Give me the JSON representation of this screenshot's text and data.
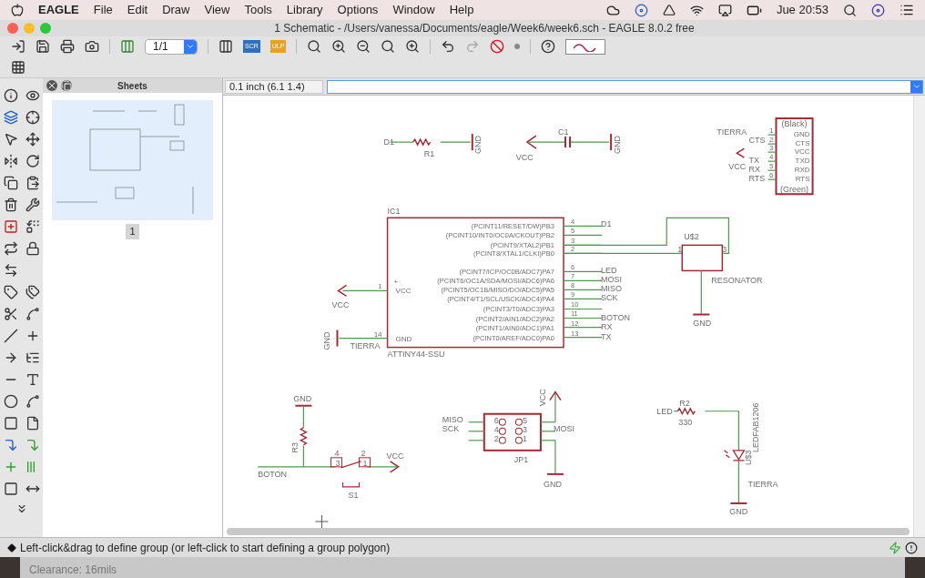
{
  "menubar": {
    "app": "EAGLE",
    "items": [
      "File",
      "Edit",
      "Draw",
      "View",
      "Tools",
      "Library",
      "Options",
      "Window",
      "Help"
    ],
    "clock": "Jue 20:53"
  },
  "window": {
    "title": "1 Schematic - /Users/vanessa/Documents/eagle/Week6/week6.sch - EAGLE 8.0.2 free"
  },
  "toolbar": {
    "sheet_select": "1/1",
    "script_label": "SCR",
    "ulp_label": "ULP"
  },
  "sheets_panel": {
    "title": "Sheets",
    "sheets": [
      {
        "label": "1",
        "selected": true
      }
    ]
  },
  "command_bar": {
    "grid_readout": "0.1 inch (6.1 1.4)"
  },
  "schematic": {
    "labels": [
      "D1",
      "R1",
      "GND",
      "C1",
      "VCC",
      "GND",
      "TIERRA",
      "CTS",
      "VCC",
      "TX",
      "RX",
      "RTS",
      "D1",
      "LED",
      "MOSI",
      "MISO",
      "SCK",
      "BOTON",
      "RX",
      "TX",
      "VCC",
      "GND",
      "TIERRA",
      "U$2",
      "1",
      "3",
      "RESONATOR",
      "GND",
      "GND",
      "R3",
      "BOTON",
      "4",
      "2",
      "3",
      "1",
      "VCC",
      "S1",
      "MISO",
      "SCK",
      "MOSI",
      "JP1",
      "VCC",
      "GND",
      "6",
      "4",
      "2",
      "5",
      "3",
      "1",
      "LED",
      "R2",
      "330",
      "U$3",
      "LEDFAB1206",
      "TIERRA",
      "GND"
    ],
    "connector": {
      "header": "(Black)",
      "footer": "(Green)",
      "pins": [
        {
          "name": "GND",
          "number": "1"
        },
        {
          "name": "CTS",
          "number": "2"
        },
        {
          "name": "VCC",
          "number": "3"
        },
        {
          "name": "TXD",
          "number": "4"
        },
        {
          "name": "RXD",
          "number": "5"
        },
        {
          "name": "RTS",
          "number": "6"
        }
      ]
    },
    "ic": {
      "name": "IC1",
      "value": "ATTINY44-SSU",
      "left_pins": [
        {
          "name": "VCC",
          "number": "1",
          "symbol": "+"
        },
        {
          "name": "GND",
          "number": "14"
        }
      ],
      "right_pins": [
        {
          "name": "(PCINT11/RESET/DW)PB3",
          "number": "4"
        },
        {
          "name": "(PCINT10/INT0/OC0A/CKOUT)PB2",
          "number": "5"
        },
        {
          "name": "(PCINT9/XTAL2)PB1",
          "number": "3"
        },
        {
          "name": "(PCINT8/XTAL1/CLKI)PB0",
          "number": "2"
        },
        {
          "name": "(PCINT7/ICP/OC0B/ADC7)PA7",
          "number": "6"
        },
        {
          "name": "(PCINT6/OC1A/SDA/MOSI/ADC6)PA6",
          "number": "7"
        },
        {
          "name": "(PCINT5/OC1B/MISO/DO/ADC5)PA5",
          "number": "8"
        },
        {
          "name": "(PCINT4/T1/SCL/USCK/ADC4)PA4",
          "number": "9"
        },
        {
          "name": "(PCINT3/T0/ADC3)PA3",
          "number": "10"
        },
        {
          "name": "(PCINT2/AIN1/ADC2)PA2",
          "number": "11"
        },
        {
          "name": "(PCINT1/AIN0/ADC1)PA1",
          "number": "12"
        },
        {
          "name": "(PCINT0/AREF/ADC0)PA0",
          "number": "13"
        }
      ]
    }
  },
  "status_bar": {
    "message": "Left-click&drag to define group (or left-click to start defining a group polygon)"
  },
  "background_window": {
    "text": "Clearance: 16mils"
  }
}
